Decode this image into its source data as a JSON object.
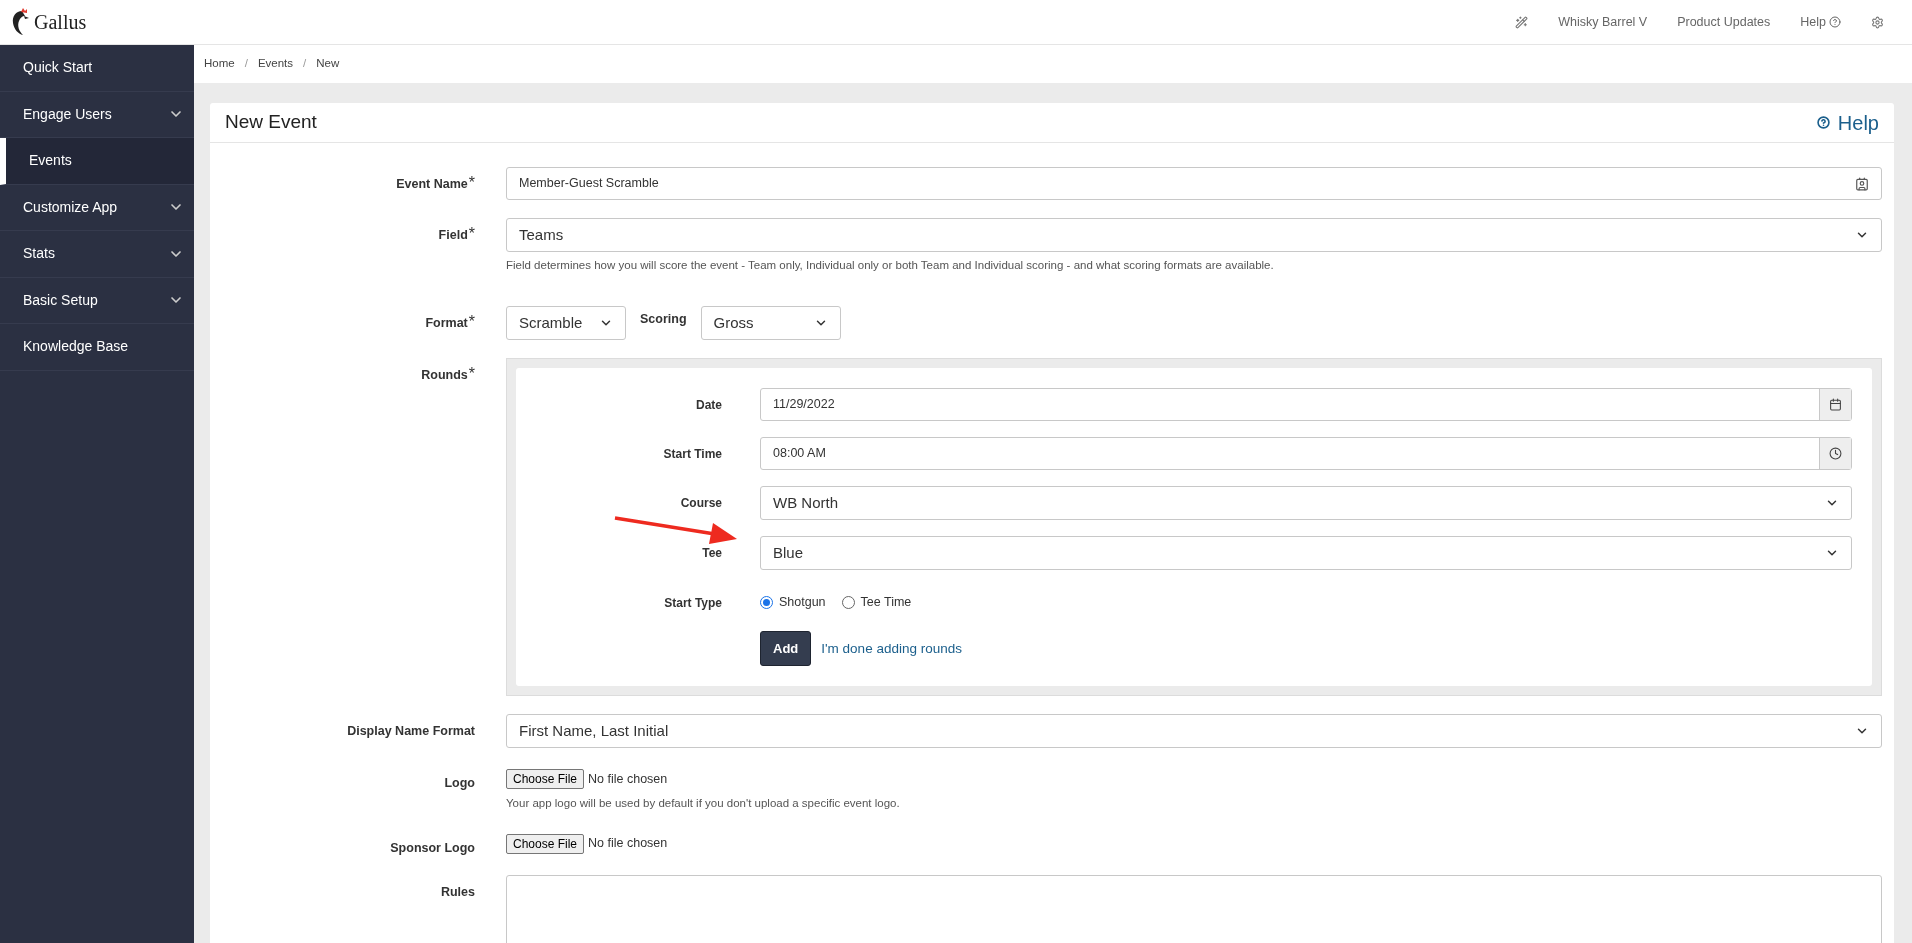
{
  "app": {
    "name": "Gallus"
  },
  "top_nav": {
    "org": "Whisky Barrel V",
    "links": [
      {
        "label": "Product Updates",
        "kind": "text"
      },
      {
        "label": "Help",
        "kind": "help"
      }
    ]
  },
  "sidebar": {
    "items": [
      {
        "label": "Quick Start",
        "expandable": false,
        "selected": false
      },
      {
        "label": "Engage Users",
        "expandable": true,
        "selected": false
      },
      {
        "label": "Events",
        "expandable": false,
        "selected": true
      },
      {
        "label": "Customize App",
        "expandable": true,
        "selected": false
      },
      {
        "label": "Stats",
        "expandable": true,
        "selected": false
      },
      {
        "label": "Basic Setup",
        "expandable": true,
        "selected": false
      },
      {
        "label": "Knowledge Base",
        "expandable": false,
        "selected": false
      }
    ]
  },
  "breadcrumb": {
    "items": [
      "Home",
      "Events",
      "New"
    ],
    "separators": [
      "/",
      "/"
    ]
  },
  "page": {
    "title": "New Event",
    "help_link": "Help"
  },
  "form": [
    {
      "kind": "text",
      "label": "Event Name",
      "mark": "*",
      "value": "Member-Guest Scramble"
    },
    {
      "kind": "select",
      "label": "Field",
      "mark": "*",
      "value": "Teams",
      "hint": "Field determines how you will score the event - Team only, Individual only or both Team and Individual scoring - and what scoring formats are available."
    },
    {
      "kind": "pair",
      "label": "Format",
      "mark": "*",
      "value": "Scramble",
      "second_label": "Scoring",
      "second_value": "Gross"
    },
    {
      "kind": "rounds",
      "label": "Rounds",
      "mark": "*",
      "rows": [
        {
          "kind": "date",
          "label": "Date",
          "value": "11/29/2022"
        },
        {
          "kind": "time",
          "label": "Start Time",
          "value": "08:00 AM"
        },
        {
          "kind": "select",
          "label": "Course",
          "value": "WB North"
        },
        {
          "kind": "select",
          "label": "Tee",
          "value": "Blue",
          "annotated": true
        },
        {
          "kind": "radio",
          "label": "Start Type",
          "options": [
            {
              "label": "Shotgun",
              "selected": true
            },
            {
              "label": "Tee Time",
              "selected": false
            }
          ]
        }
      ],
      "add_button": "Add",
      "done_link": "I'm done adding rounds"
    },
    {
      "kind": "select",
      "label": "Display Name Format",
      "value": "First Name, Last Initial"
    },
    {
      "kind": "file",
      "label": "Logo",
      "button": "Choose File",
      "status": "No file chosen",
      "hint": "Your app logo will be used by default if you don't upload a specific event logo."
    },
    {
      "kind": "file",
      "label": "Sponsor Logo",
      "button": "Choose File",
      "status": "No file chosen"
    },
    {
      "kind": "textarea",
      "label": "Rules"
    }
  ]
}
